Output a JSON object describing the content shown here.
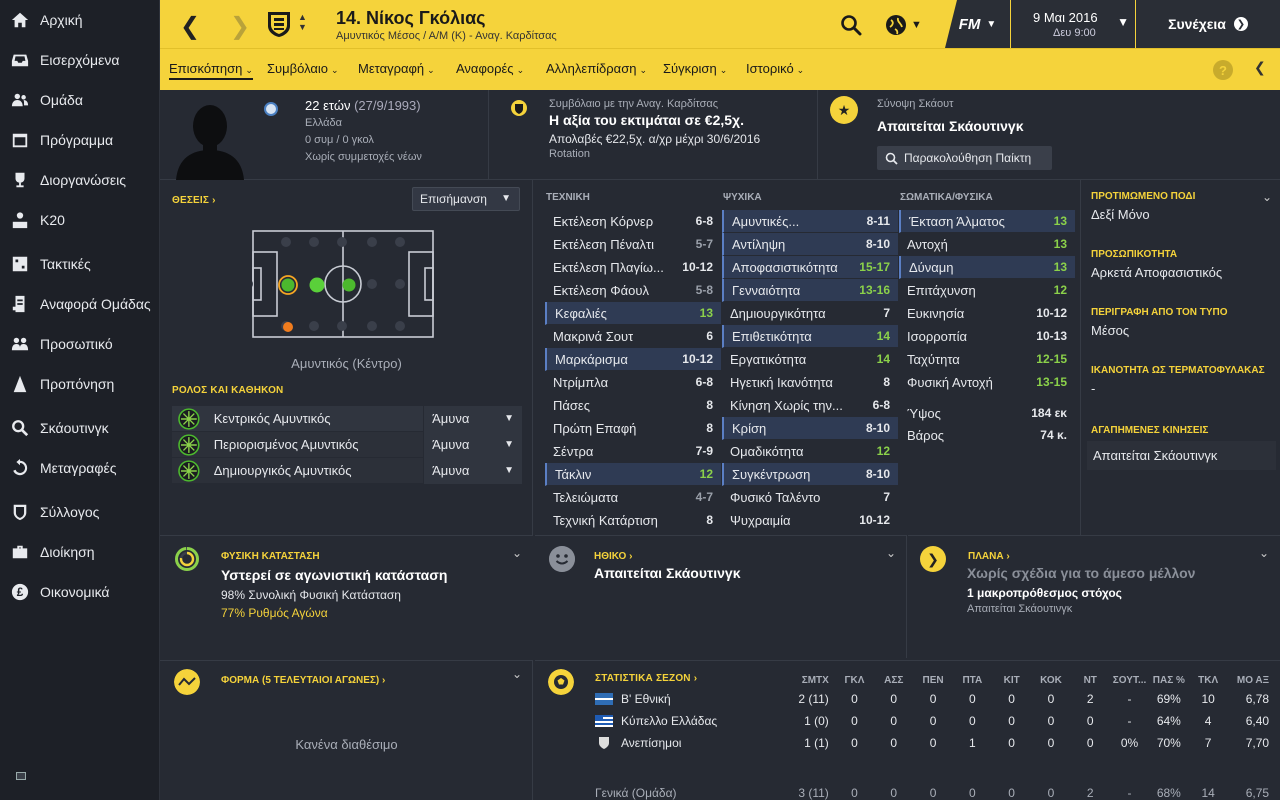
{
  "sidebar": {
    "items": [
      {
        "label": "Αρχική",
        "icon": "home-icon"
      },
      {
        "label": "Εισερχόμενα",
        "icon": "inbox-icon"
      },
      {
        "label": "Ομάδα",
        "icon": "squad-icon"
      },
      {
        "label": "Πρόγραμμα",
        "icon": "calendar-icon"
      },
      {
        "label": "Διοργανώσεις",
        "icon": "trophy-icon"
      },
      {
        "label": "Κ20",
        "icon": "youth-icon"
      },
      {
        "label": "Τακτικές",
        "icon": "tactics-icon"
      },
      {
        "label": "Αναφορά Ομάδας",
        "icon": "report-icon"
      },
      {
        "label": "Προσωπικό",
        "icon": "staff-icon"
      },
      {
        "label": "Προπόνηση",
        "icon": "training-icon"
      },
      {
        "label": "Σκάουτινγκ",
        "icon": "scouting-icon"
      },
      {
        "label": "Μεταγραφές",
        "icon": "transfers-icon"
      },
      {
        "label": "Σύλλογος",
        "icon": "club-icon"
      },
      {
        "label": "Διοίκηση",
        "icon": "board-icon"
      },
      {
        "label": "Οικονομικά",
        "icon": "finances-icon"
      }
    ]
  },
  "header": {
    "player_title": "14. Νίκος Γκόλιας",
    "player_sub": "Αμυντικός Μέσος / Α/Μ (Κ) - Αναγ. Καρδίτσας",
    "fm_label": "FM",
    "date": "9 Μαι 2016",
    "time": "Δευ 9:00",
    "continue_label": "Συνέχεια"
  },
  "tabs": [
    {
      "label": "Επισκόπηση"
    },
    {
      "label": "Συμβόλαιο"
    },
    {
      "label": "Μεταγραφή"
    },
    {
      "label": "Αναφορές"
    },
    {
      "label": "Αλληλεπίδραση"
    },
    {
      "label": "Σύγκριση"
    },
    {
      "label": "Ιστορικό"
    }
  ],
  "info": {
    "age": "22 ετών",
    "dob": "(27/9/1993)",
    "nation": "Ελλάδα",
    "caps": "0 συμ / 0 γκολ",
    "youth": "Χωρίς συμμετοχές νέων",
    "contract_label": "Συμβόλαιο με την Αναγ. Καρδίτσας",
    "contract_value": "Η αξία του εκτιμάται σε €2,5χ.",
    "contract_wage": "Απολαβές €22,5χ. α/χρ μέχρι 30/6/2016",
    "contract_role": "Rotation",
    "scout_label": "Σύνοψη Σκάουτ",
    "scout_main": "Απαιτείται Σκάουτινγκ",
    "track_button": "Παρακολούθηση Παίκτη"
  },
  "positions": {
    "title": "ΘΕΣΕΙΣ",
    "highlight_select": "Επισήμανση",
    "position_name": "Αμυντικός (Κέντρο)",
    "role_title": "ΡΟΛΟΣ ΚΑΙ ΚΑΘΗΚΟΝ",
    "roles": [
      {
        "name": "Κεντρικός Αμυντικός",
        "duty": "Άμυνα"
      },
      {
        "name": "Περιορισμένος Αμυντικός",
        "duty": "Άμυνα"
      },
      {
        "name": "Δημιουργικός Αμυντικός",
        "duty": "Άμυνα"
      }
    ]
  },
  "technical": {
    "title": "ΤΕΧΝΙΚΗ",
    "rows": [
      {
        "name": "Εκτέλεση Κόρνερ",
        "value": "6-8",
        "hl": false,
        "tone": ""
      },
      {
        "name": "Εκτέλεση Πέναλτι",
        "value": "5-7",
        "hl": false,
        "tone": "dim"
      },
      {
        "name": "Εκτέλεση Πλαγίω...",
        "value": "10-12",
        "hl": false,
        "tone": ""
      },
      {
        "name": "Εκτέλεση Φάουλ",
        "value": "5-8",
        "hl": false,
        "tone": "dim"
      },
      {
        "name": "Κεφαλιές",
        "value": "13",
        "hl": true,
        "tone": "green"
      },
      {
        "name": "Μακρινά Σουτ",
        "value": "6",
        "hl": false,
        "tone": ""
      },
      {
        "name": "Μαρκάρισμα",
        "value": "10-12",
        "hl": true,
        "tone": ""
      },
      {
        "name": "Ντρίμπλα",
        "value": "6-8",
        "hl": false,
        "tone": ""
      },
      {
        "name": "Πάσες",
        "value": "8",
        "hl": false,
        "tone": ""
      },
      {
        "name": "Πρώτη Επαφή",
        "value": "8",
        "hl": false,
        "tone": ""
      },
      {
        "name": "Σέντρα",
        "value": "7-9",
        "hl": false,
        "tone": ""
      },
      {
        "name": "Τάκλιν",
        "value": "12",
        "hl": true,
        "tone": "green"
      },
      {
        "name": "Τελειώματα",
        "value": "4-7",
        "hl": false,
        "tone": "dim"
      },
      {
        "name": "Τεχνική Κατάρτιση",
        "value": "8",
        "hl": false,
        "tone": ""
      }
    ]
  },
  "mental": {
    "title": "ΨΥΧΙΚΑ",
    "rows": [
      {
        "name": "Αμυντικές...",
        "value": "8-11",
        "hl": true,
        "tone": ""
      },
      {
        "name": "Αντίληψη",
        "value": "8-10",
        "hl": true,
        "tone": ""
      },
      {
        "name": "Αποφασιστικότητα",
        "value": "15-17",
        "hl": true,
        "tone": "green"
      },
      {
        "name": "Γενναιότητα",
        "value": "13-16",
        "hl": true,
        "tone": "green"
      },
      {
        "name": "Δημιουργικότητα",
        "value": "7",
        "hl": false,
        "tone": ""
      },
      {
        "name": "Επιθετικότητα",
        "value": "14",
        "hl": true,
        "tone": "green"
      },
      {
        "name": "Εργατικότητα",
        "value": "14",
        "hl": false,
        "tone": "green"
      },
      {
        "name": "Ηγετική Ικανότητα",
        "value": "8",
        "hl": false,
        "tone": ""
      },
      {
        "name": "Κίνηση Χωρίς την...",
        "value": "6-8",
        "hl": false,
        "tone": ""
      },
      {
        "name": "Κρίση",
        "value": "8-10",
        "hl": true,
        "tone": ""
      },
      {
        "name": "Ομαδικότητα",
        "value": "12",
        "hl": false,
        "tone": "green"
      },
      {
        "name": "Συγκέντρωση",
        "value": "8-10",
        "hl": true,
        "tone": ""
      },
      {
        "name": "Φυσικό Ταλέντο",
        "value": "7",
        "hl": false,
        "tone": ""
      },
      {
        "name": "Ψυχραιμία",
        "value": "10-12",
        "hl": false,
        "tone": ""
      }
    ]
  },
  "physical": {
    "title": "ΣΩΜΑΤΙΚΑ/ΦΥΣΙΚΑ",
    "rows": [
      {
        "name": "Έκταση Άλματος",
        "value": "13",
        "hl": true,
        "tone": "green"
      },
      {
        "name": "Αντοχή",
        "value": "13",
        "hl": false,
        "tone": "green"
      },
      {
        "name": "Δύναμη",
        "value": "13",
        "hl": true,
        "tone": "green"
      },
      {
        "name": "Επιτάχυνση",
        "value": "12",
        "hl": false,
        "tone": "green"
      },
      {
        "name": "Ευκινησία",
        "value": "10-12",
        "hl": false,
        "tone": ""
      },
      {
        "name": "Ισορροπία",
        "value": "10-13",
        "hl": false,
        "tone": ""
      },
      {
        "name": "Ταχύτητα",
        "value": "12-15",
        "hl": false,
        "tone": "green"
      },
      {
        "name": "Φυσική Αντοχή",
        "value": "13-15",
        "hl": false,
        "tone": "green"
      }
    ],
    "height_label": "Ύψος",
    "height_value": "184 εκ",
    "weight_label": "Βάρος",
    "weight_value": "74 κ."
  },
  "right": {
    "foot_label": "ΠΡΟΤΙΜΩΜΕΝΟ ΠΟΔΙ",
    "foot_value": "Δεξί Μόνο",
    "personality_label": "ΠΡΟΣΩΠΙΚΟΤΗΤΑ",
    "personality_value": "Αρκετά Αποφασιστικός",
    "media_label": "ΠΕΡΙΓΡΑΦΗ ΑΠΟ ΤΟΝ ΤΥΠΟ",
    "media_value": "Μέσος",
    "gk_label": "ΙΚΑΝΟΤΗΤΑ ΩΣ ΤΕΡΜΑΤΟΦΥΛΑΚΑΣ",
    "gk_value": "-",
    "moves_label": "ΑΓΑΠΗΜΕΝΕΣ ΚΙΝΗΣΕΙΣ",
    "moves_value": "Απαιτείται Σκάουτινγκ"
  },
  "condition": {
    "label": "ΦΥΣΙΚΗ ΚΑΤΑΣΤΑΣΗ",
    "main": "Υστερεί σε αγωνιστική κατάσταση",
    "fitness": "98% Συνολική Φυσική Κατάσταση",
    "sharpness": "77% Ρυθμός Αγώνα",
    "fitness_pct": 0.98,
    "sharpness_pct": 0.77
  },
  "morale": {
    "label": "ΗΘΙΚΟ",
    "main": "Απαιτείται Σκάουτινγκ"
  },
  "plans": {
    "label": "ΠΛΑΝΑ",
    "main": "Χωρίς σχέδια για το άμεσο μέλλον",
    "goal": "1 μακροπρόθεσμος στόχος",
    "note": "Απαιτείται Σκάουτινγκ"
  },
  "form": {
    "label": "ΦΟΡΜΑ (5 ΤΕΛΕΥΤΑΙΟΙ ΑΓΩΝΕΣ)",
    "empty": "Κανένα διαθέσιμο"
  },
  "stats": {
    "title": "ΣΤΑΤΙΣΤΙΚΑ ΣΕΖΟΝ",
    "columns": [
      "ΣΜΤΧ",
      "ΓΚΛ",
      "ΑΣΣ",
      "ΠΕΝ",
      "ΠΤΑ",
      "ΚΙΤ",
      "ΚΟΚ",
      "ΝΤ",
      "ΣΟΥΤ...",
      "ΠΑΣ %",
      "ΤΚΛ",
      "ΜΟ ΑΞ"
    ],
    "rows": [
      {
        "name": "Β' Εθνική",
        "cells": [
          "2 (11)",
          "0",
          "0",
          "0",
          "0",
          "0",
          "0",
          "2",
          "-",
          "69%",
          "10",
          "6,78"
        ]
      },
      {
        "name": "Κύπελλο Ελλάδας",
        "cells": [
          "1 (0)",
          "0",
          "0",
          "0",
          "0",
          "0",
          "0",
          "0",
          "-",
          "64%",
          "4",
          "6,40"
        ]
      },
      {
        "name": "Ανεπίσημοι",
        "cells": [
          "1 (1)",
          "0",
          "0",
          "0",
          "1",
          "0",
          "0",
          "0",
          "0%",
          "70%",
          "7",
          "7,70"
        ]
      },
      {
        "name": "Γενικά (Ομάδα)",
        "cells": [
          "3 (11)",
          "0",
          "0",
          "0",
          "0",
          "0",
          "0",
          "2",
          "-",
          "68%",
          "14",
          "6,75"
        ]
      }
    ]
  },
  "colors": {
    "accent": "#f5d33b",
    "panel": "#262a33",
    "sidebar": "#1d2027",
    "positive": "#8bd14a"
  }
}
